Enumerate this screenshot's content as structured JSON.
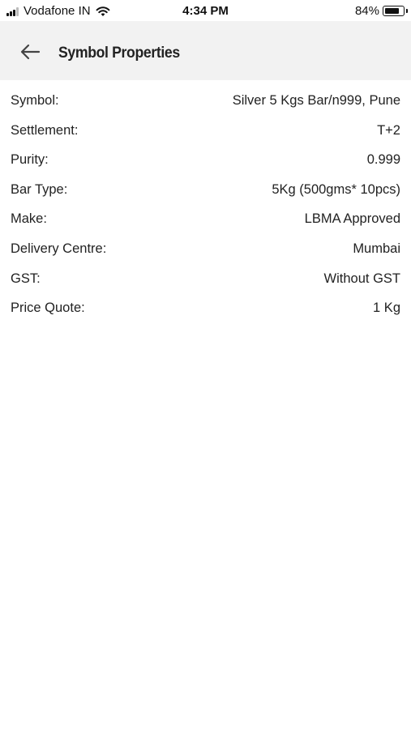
{
  "status_bar": {
    "carrier": "Vodafone IN",
    "time": "4:34 PM",
    "battery_percent": "84%",
    "battery_level": 0.84,
    "signal_bars": 3
  },
  "header": {
    "back_icon": "arrow-left-icon",
    "title": "Symbol Properties",
    "background": "#f2f2f2"
  },
  "properties": [
    {
      "label": "Symbol:",
      "value": "Silver 5 Kgs Bar/n999, Pune"
    },
    {
      "label": "Settlement:",
      "value": "T+2"
    },
    {
      "label": "Purity:",
      "value": "0.999"
    },
    {
      "label": "Bar Type:",
      "value": "5Kg (500gms* 10pcs)"
    },
    {
      "label": "Make:",
      "value": "LBMA Approved"
    },
    {
      "label": "Delivery Centre:",
      "value": "Mumbai"
    },
    {
      "label": "GST:",
      "value": "Without GST"
    },
    {
      "label": "Price Quote:",
      "value": "1 Kg"
    }
  ]
}
